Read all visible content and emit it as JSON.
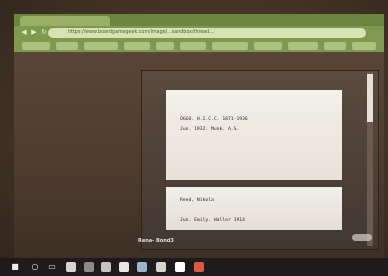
{
  "browser": {
    "url": "https://www.boardgamegeek.com/image/...sandbox/thread..."
  },
  "viewer": {
    "title_line_1": "OGGO. H.I.C.C. 1871-1936",
    "title_line_2": "Jun. 1932. Munk. A.S.",
    "lower_line_1": "Reed, Nikola",
    "lower_line_2": "Jun. Emily. Haller 1914",
    "status_label": "Rena- Bond3"
  },
  "taskbar": {
    "start_icon": "start-icon",
    "search_icon": "search-icon",
    "task_view_icon": "task-view-icon"
  }
}
